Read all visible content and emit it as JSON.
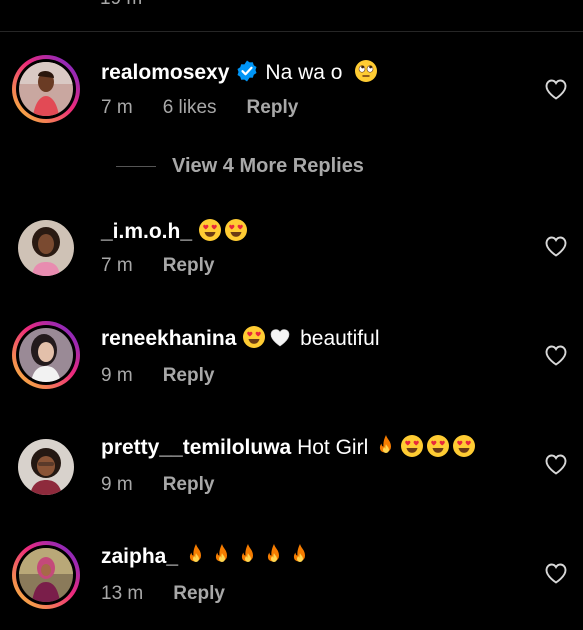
{
  "top_partial_time": "19 m",
  "comments": [
    {
      "username": "realomosexy",
      "verified": true,
      "text": "Na wa o",
      "emojis": [
        "eye-roll"
      ],
      "time": "7 m",
      "likes": "6 likes",
      "reply_label": "Reply",
      "has_story_ring": true
    },
    {
      "username": "_i.m.o.h_",
      "verified": false,
      "text": "",
      "emojis": [
        "heart-eyes",
        "heart-eyes"
      ],
      "time": "7 m",
      "likes": "",
      "reply_label": "Reply",
      "has_story_ring": false
    },
    {
      "username": "reneekhanina",
      "verified": false,
      "text": "beautiful",
      "emojis": [
        "heart-eyes",
        "white-heart"
      ],
      "time": "9 m",
      "likes": "",
      "reply_label": "Reply",
      "has_story_ring": true
    },
    {
      "username": "pretty__temiloluwa",
      "verified": false,
      "text": "Hot Girl",
      "emojis": [
        "fire",
        "heart-eyes",
        "heart-eyes",
        "heart-eyes"
      ],
      "time": "9 m",
      "likes": "",
      "reply_label": "Reply",
      "has_story_ring": false
    },
    {
      "username": "zaipha_",
      "verified": false,
      "text": "",
      "emojis": [
        "fire",
        "fire",
        "fire",
        "fire",
        "fire"
      ],
      "time": "13 m",
      "likes": "",
      "reply_label": "Reply",
      "has_story_ring": true
    }
  ],
  "view_more_replies": "View 4 More Replies",
  "colors": {
    "background": "#000000",
    "secondary_text": "#a8a8a8",
    "verified_blue": "#0095f6"
  }
}
